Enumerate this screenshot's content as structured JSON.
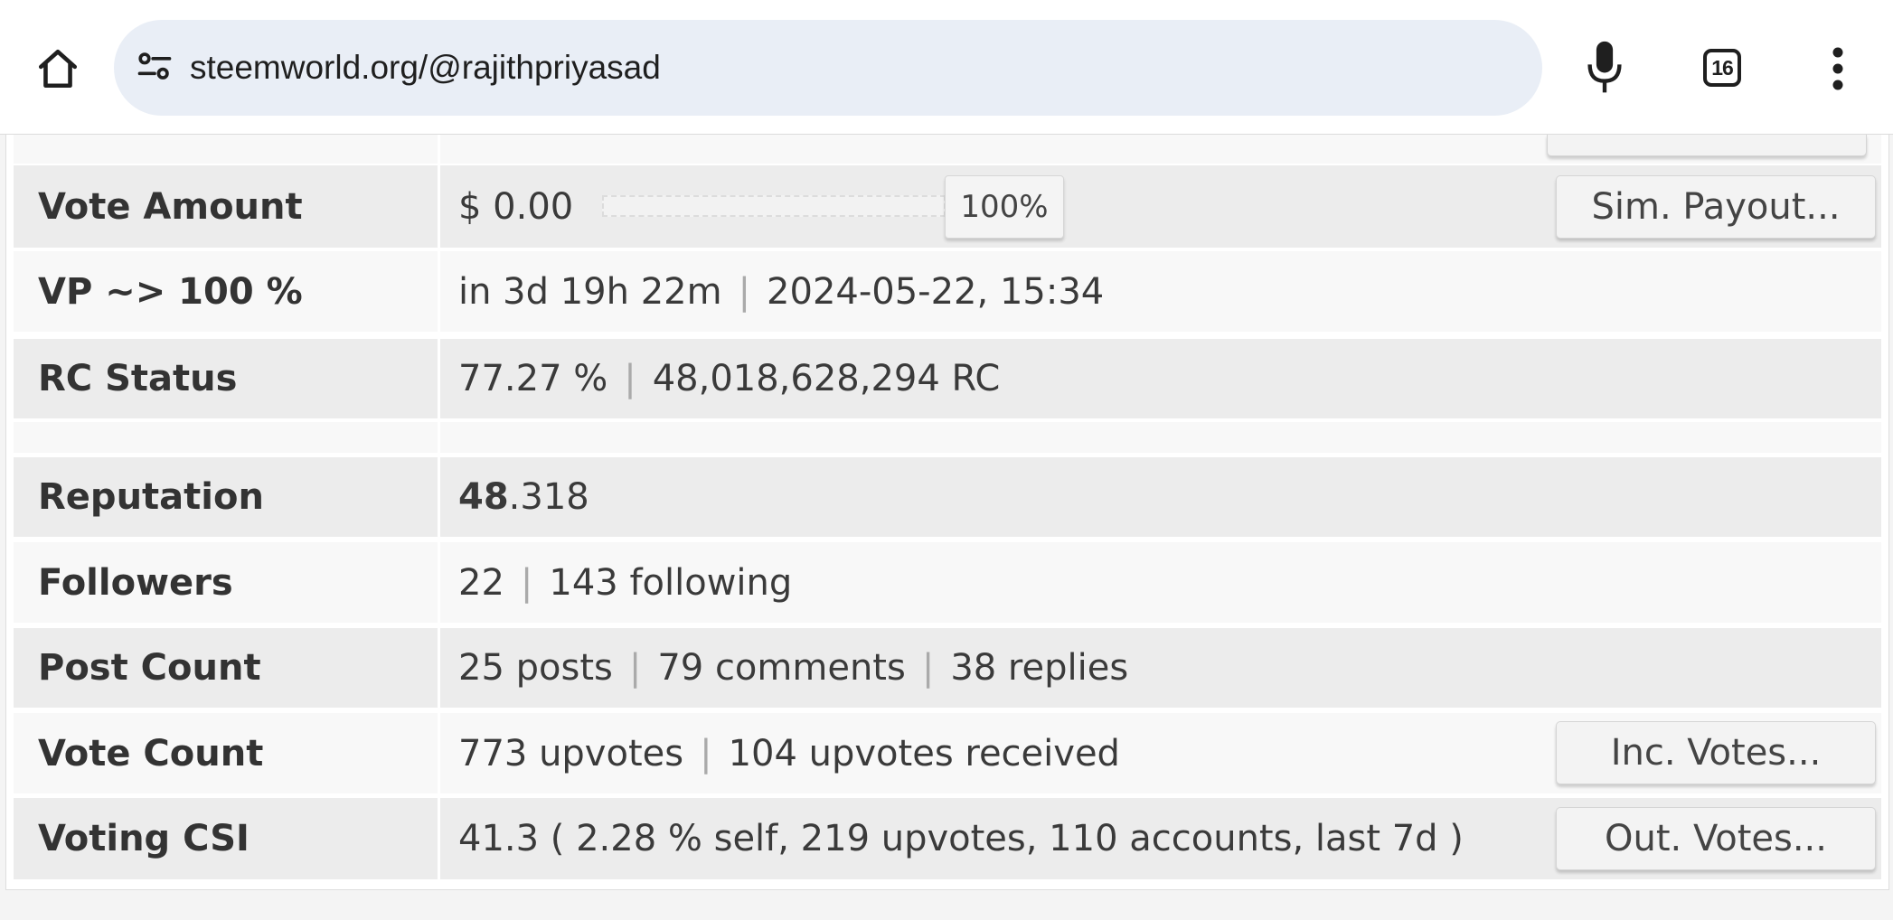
{
  "browser": {
    "url": "steemworld.org/@rajithpriyasad",
    "tab_count": "16"
  },
  "account": {
    "vote_amount": {
      "label": "Vote Amount",
      "value": "$ 0.00",
      "weight_percent": "100%",
      "weight_fraction": 1.0,
      "button": "Sim. Payout..."
    },
    "vp_full": {
      "label": "VP ~> 100 %",
      "in_time": "in 3d 19h 22m",
      "datetime": "2024-05-22, 15:34"
    },
    "rc_status": {
      "label": "RC Status",
      "percent": "77.27 %",
      "amount": "48,018,628,294 RC"
    },
    "reputation": {
      "label": "Reputation",
      "integer": "48",
      "decimal": ".318"
    },
    "followers": {
      "label": "Followers",
      "count": "22",
      "following": "143 following"
    },
    "post_count": {
      "label": "Post Count",
      "posts": "25 posts",
      "comments": "79 comments",
      "replies": "38 replies"
    },
    "vote_count": {
      "label": "Vote Count",
      "upvotes": "773 upvotes",
      "received": "104 upvotes received",
      "button": "Inc. Votes..."
    },
    "voting_csi": {
      "label": "Voting CSI",
      "value": "41.3 ( 2.28 % self, 219 upvotes, 110 accounts, last 7d )",
      "button": "Out. Votes..."
    }
  }
}
